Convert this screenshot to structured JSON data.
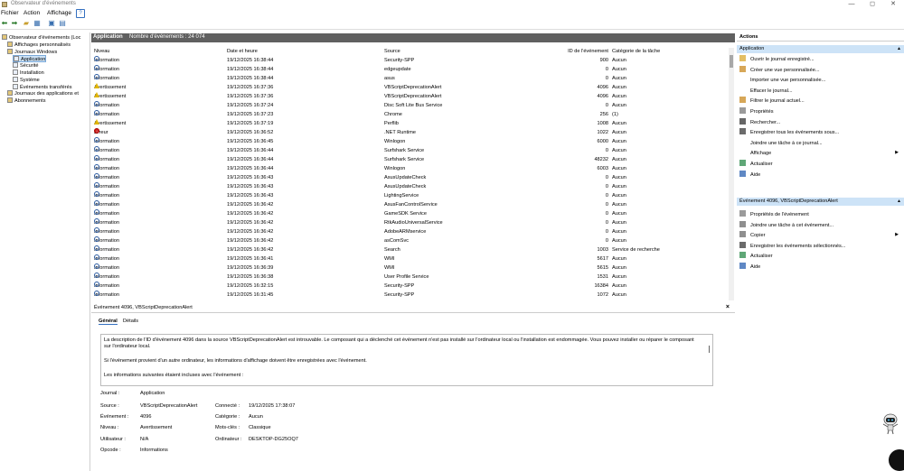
{
  "window": {
    "title": "Observateur d'événements",
    "controls": [
      "—",
      "◻",
      "✕"
    ]
  },
  "menu": {
    "items": [
      "Fichier",
      "Action",
      "Affichage"
    ],
    "help": "?"
  },
  "tree": [
    {
      "label": "Observateur d'événements (Loc",
      "indent": 0
    },
    {
      "label": "Affichages personnalisés",
      "indent": 1
    },
    {
      "label": "Journaux Windows",
      "indent": 1
    },
    {
      "label": "Application",
      "indent": 2,
      "selected": true
    },
    {
      "label": "Sécurité",
      "indent": 2
    },
    {
      "label": "Installation",
      "indent": 2
    },
    {
      "label": "Système",
      "indent": 2
    },
    {
      "label": "Événements transférés",
      "indent": 2
    },
    {
      "label": "Journaux des applications et",
      "indent": 1
    },
    {
      "label": "Abonnements",
      "indent": 1
    }
  ],
  "center": {
    "title": "Application",
    "count": "Nombre d'événements : 24 074"
  },
  "columns": [
    "Niveau",
    "Date et heure",
    "Source",
    "ID de l'événement",
    "Catégorie de la tâche"
  ],
  "rows": [
    {
      "level": "Information",
      "date": "19/12/2025 16:38:44",
      "source": "Security-SPP",
      "id": "900",
      "cat": "Aucun",
      "kind": "info"
    },
    {
      "level": "Information",
      "date": "19/12/2025 16:38:44",
      "source": "edgeupdate",
      "id": "0",
      "cat": "Aucun",
      "kind": "info"
    },
    {
      "level": "Information",
      "date": "19/12/2025 16:38:44",
      "source": "asus",
      "id": "0",
      "cat": "Aucun",
      "kind": "info"
    },
    {
      "level": "Avertissement",
      "date": "19/12/2025 16:37:36",
      "source": "VBScriptDeprecationAlert",
      "id": "4096",
      "cat": "Aucun",
      "kind": "warn"
    },
    {
      "level": "Avertissement",
      "date": "19/12/2025 16:37:36",
      "source": "VBScriptDeprecationAlert",
      "id": "4096",
      "cat": "Aucun",
      "kind": "warn"
    },
    {
      "level": "Information",
      "date": "19/12/2025 16:37:24",
      "source": "Disc Soft Lite Bus Service",
      "id": "0",
      "cat": "Aucun",
      "kind": "info"
    },
    {
      "level": "Information",
      "date": "19/12/2025 16:37:23",
      "source": "Chrome",
      "id": "256",
      "cat": "(1)",
      "kind": "info"
    },
    {
      "level": "Avertissement",
      "date": "19/12/2025 16:37:19",
      "source": "Perflib",
      "id": "1008",
      "cat": "Aucun",
      "kind": "warn"
    },
    {
      "level": "Erreur",
      "date": "19/12/2025 16:36:52",
      "source": ".NET Runtime",
      "id": "1022",
      "cat": "Aucun",
      "kind": "err"
    },
    {
      "level": "Information",
      "date": "19/12/2025 16:36:45",
      "source": "Winlogon",
      "id": "6000",
      "cat": "Aucun",
      "kind": "info"
    },
    {
      "level": "Information",
      "date": "19/12/2025 16:36:44",
      "source": "Surfshark Service",
      "id": "0",
      "cat": "Aucun",
      "kind": "info"
    },
    {
      "level": "Information",
      "date": "19/12/2025 16:36:44",
      "source": "Surfshark Service",
      "id": "48232",
      "cat": "Aucun",
      "kind": "info"
    },
    {
      "level": "Information",
      "date": "19/12/2025 16:36:44",
      "source": "Winlogon",
      "id": "6003",
      "cat": "Aucun",
      "kind": "info"
    },
    {
      "level": "Information",
      "date": "19/12/2025 16:36:43",
      "source": "AsusUpdateCheck",
      "id": "0",
      "cat": "Aucun",
      "kind": "info"
    },
    {
      "level": "Information",
      "date": "19/12/2025 16:36:43",
      "source": "AsusUpdateCheck",
      "id": "0",
      "cat": "Aucun",
      "kind": "info"
    },
    {
      "level": "Information",
      "date": "19/12/2025 16:36:43",
      "source": "LightingService",
      "id": "0",
      "cat": "Aucun",
      "kind": "info"
    },
    {
      "level": "Information",
      "date": "19/12/2025 16:36:42",
      "source": "AsusFanControlService",
      "id": "0",
      "cat": "Aucun",
      "kind": "info"
    },
    {
      "level": "Information",
      "date": "19/12/2025 16:36:42",
      "source": "GameSDK Service",
      "id": "0",
      "cat": "Aucun",
      "kind": "info"
    },
    {
      "level": "Information",
      "date": "19/12/2025 16:36:42",
      "source": "RtkAudioUniversalService",
      "id": "0",
      "cat": "Aucun",
      "kind": "info"
    },
    {
      "level": "Information",
      "date": "19/12/2025 16:36:42",
      "source": "AdobeARMservice",
      "id": "0",
      "cat": "Aucun",
      "kind": "info"
    },
    {
      "level": "Information",
      "date": "19/12/2025 16:36:42",
      "source": "asComSvc",
      "id": "0",
      "cat": "Aucun",
      "kind": "info"
    },
    {
      "level": "Information",
      "date": "19/12/2025 16:36:42",
      "source": "Search",
      "id": "1003",
      "cat": "Service de recherche",
      "kind": "info"
    },
    {
      "level": "Information",
      "date": "19/12/2025 16:36:41",
      "source": "WMI",
      "id": "5617",
      "cat": "Aucun",
      "kind": "info"
    },
    {
      "level": "Information",
      "date": "19/12/2025 16:36:39",
      "source": "WMI",
      "id": "5615",
      "cat": "Aucun",
      "kind": "info"
    },
    {
      "level": "Information",
      "date": "19/12/2025 16:36:38",
      "source": "User Profile Service",
      "id": "1531",
      "cat": "Aucun",
      "kind": "info"
    },
    {
      "level": "Information",
      "date": "19/12/2025 16:32:15",
      "source": "Security-SPP",
      "id": "16384",
      "cat": "Aucun",
      "kind": "info"
    },
    {
      "level": "Information",
      "date": "19/12/2025 16:31:45",
      "source": "Security-SPP",
      "id": "1072",
      "cat": "Aucun",
      "kind": "info"
    }
  ],
  "detail": {
    "title": "Événement 4096, VBScriptDeprecationAlert",
    "tabs": [
      "Général",
      "Détails"
    ],
    "desc": [
      "La description de l'ID d'événement 4096 dans la source VBScriptDeprecationAlert est introuvable. Le composant qui a déclenché cet événement n'est pas installé sur l'ordinateur local ou l'installation est endommagée. Vous pouvez installer ou réparer le composant sur l'ordinateur local.",
      "Si l'événement provient d'un autre ordinateur, les informations d'affichage doivent être enregistrées avec l'événement.",
      "Les informations suivantes étaient incluses avec l'événement :"
    ],
    "fields": {
      "journal_label": "Journal :",
      "journal": "Application",
      "source_label": "Source :",
      "source": "VBScriptDeprecationAlert",
      "connecte_label": "Connecté :",
      "connecte": "19/12/2025 17:38:07",
      "event_label": "Événement :",
      "event": "4096",
      "categorie_label": "Catégorie :",
      "categorie": "Aucun",
      "niveau_label": "Niveau :",
      "niveau": "Avertissement",
      "mots_label": "Mots-clés :",
      "mots": "Classique",
      "user_label": "Utilisateur :",
      "user": "N/A",
      "ordi_label": "Ordinateur :",
      "ordi": "DESKTOP-DG25OQ7",
      "opcode_label": "Opcode :",
      "opcode": "Informations"
    }
  },
  "actions": {
    "title": "Actions",
    "section1": "Application",
    "items1": [
      {
        "label": "Ouvrir le journal enregistré...",
        "icon": "folder-icon"
      },
      {
        "label": "Créer une vue personnalisée...",
        "icon": "filter-icon"
      },
      {
        "label": "Importer une vue personnalisée...",
        "icon": ""
      },
      {
        "label": "Effacer le journal...",
        "icon": ""
      },
      {
        "label": "Filtrer le journal actuel...",
        "icon": "filter-icon"
      },
      {
        "label": "Propriétés",
        "icon": "properties-icon"
      },
      {
        "label": "Rechercher...",
        "icon": "binoculars-icon"
      },
      {
        "label": "Enregistrer tous les événements sous...",
        "icon": "save-icon"
      },
      {
        "label": "Joindre une tâche à ce journal...",
        "icon": ""
      },
      {
        "label": "Affichage",
        "icon": "",
        "submenu": true
      },
      {
        "label": "Actualiser",
        "icon": "refresh-icon"
      },
      {
        "label": "Aide",
        "icon": "help-icon",
        "submenu": true
      }
    ],
    "section2": "Événement 4096, VBScriptDeprecationAlert",
    "items2": [
      {
        "label": "Propriétés de l'événement",
        "icon": "properties-icon"
      },
      {
        "label": "Joindre une tâche à cet événement...",
        "icon": "task-icon"
      },
      {
        "label": "Copier",
        "icon": "copy-icon",
        "submenu": true
      },
      {
        "label": "Enregistrer les événements sélectionnés...",
        "icon": "save-icon"
      },
      {
        "label": "Actualiser",
        "icon": "refresh-icon"
      },
      {
        "label": "Aide",
        "icon": "help-icon",
        "submenu": true
      }
    ]
  }
}
